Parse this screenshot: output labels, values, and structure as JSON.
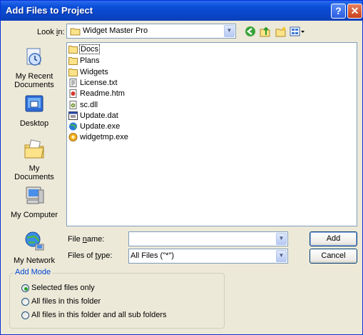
{
  "window": {
    "title": "Add Files to Project",
    "help_glyph": "?",
    "close_glyph": "✕"
  },
  "lookin": {
    "label_pre": "Look ",
    "label_accel": "i",
    "label_post": "n:",
    "value": "Widget Master Pro"
  },
  "places": [
    {
      "label": "My Recent Documents",
      "icon": "recent-documents-icon"
    },
    {
      "label": "Desktop",
      "icon": "desktop-icon"
    },
    {
      "label": "My Documents",
      "icon": "my-documents-icon"
    },
    {
      "label": "My Computer",
      "icon": "my-computer-icon"
    },
    {
      "label": "My Network",
      "icon": "my-network-icon"
    }
  ],
  "files": [
    {
      "name": "Docs",
      "icon": "folder-icon"
    },
    {
      "name": "Plans",
      "icon": "folder-icon"
    },
    {
      "name": "Widgets",
      "icon": "folder-icon"
    },
    {
      "name": "License.txt",
      "icon": "text-file-icon"
    },
    {
      "name": "Readme.htm",
      "icon": "html-file-icon"
    },
    {
      "name": "sc.dll",
      "icon": "dll-file-icon"
    },
    {
      "name": "Update.dat",
      "icon": "dat-file-icon"
    },
    {
      "name": "Update.exe",
      "icon": "globe-exe-icon"
    },
    {
      "name": "widgetmp.exe",
      "icon": "exe-file-icon"
    }
  ],
  "filename": {
    "label_pre": "File ",
    "label_accel": "n",
    "label_post": "ame:",
    "value": ""
  },
  "filetype": {
    "label_pre": "Files of ",
    "label_accel": "t",
    "label_post": "ype:",
    "value": "All Files (\"*\")"
  },
  "buttons": {
    "add": "Add",
    "cancel": "Cancel"
  },
  "add_mode": {
    "legend": "Add Mode",
    "options": [
      "Selected files only",
      "All files in this folder",
      "All files in this folder and all sub folders"
    ],
    "selected": 0
  },
  "colors": {
    "title_bar": "#0a4ed8",
    "dialog_bg": "#ece9d8",
    "legend": "#0046d5",
    "radio_dot": "#21a121"
  }
}
